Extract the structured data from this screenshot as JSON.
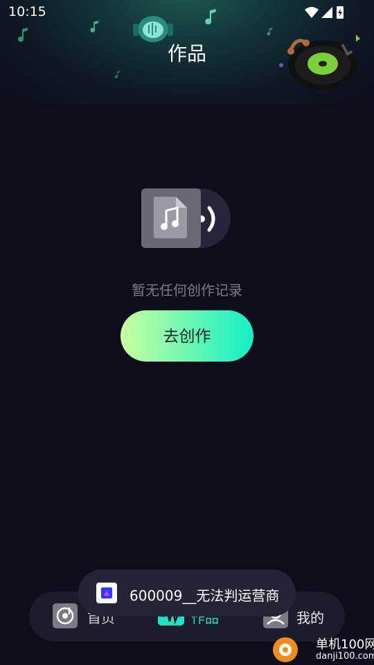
{
  "status_bar": {
    "time": "10:15",
    "icons": [
      "wifi-icon",
      "signal-icon",
      "battery-charging-icon"
    ]
  },
  "header": {
    "title": "作品",
    "decorations": [
      "music-note-icon",
      "astronaut-headphones-icon",
      "vinyl-record-icon"
    ]
  },
  "empty_state": {
    "icon": "audio-file-icon",
    "message": "暂无任何创作记录",
    "action_label": "去创作"
  },
  "tabbar": {
    "items": [
      {
        "label": "首页",
        "icon": "music-disc-icon",
        "active": false
      },
      {
        "label": "作品",
        "icon": "waveform-icon",
        "active": true
      },
      {
        "label": "我的",
        "icon": "profile-icon",
        "active": false
      }
    ]
  },
  "toast": {
    "message": "600009__无法判运营商",
    "icon": "app-icon"
  },
  "watermark": {
    "title": "单机100网",
    "subtitle": "danji100.com"
  },
  "colors": {
    "background": "#0d0d1c",
    "accent_start": "#c9ff9e",
    "accent_end": "#11f0c8",
    "active_tab": "#1ee3c0",
    "muted_text": "#7c7c8c"
  }
}
